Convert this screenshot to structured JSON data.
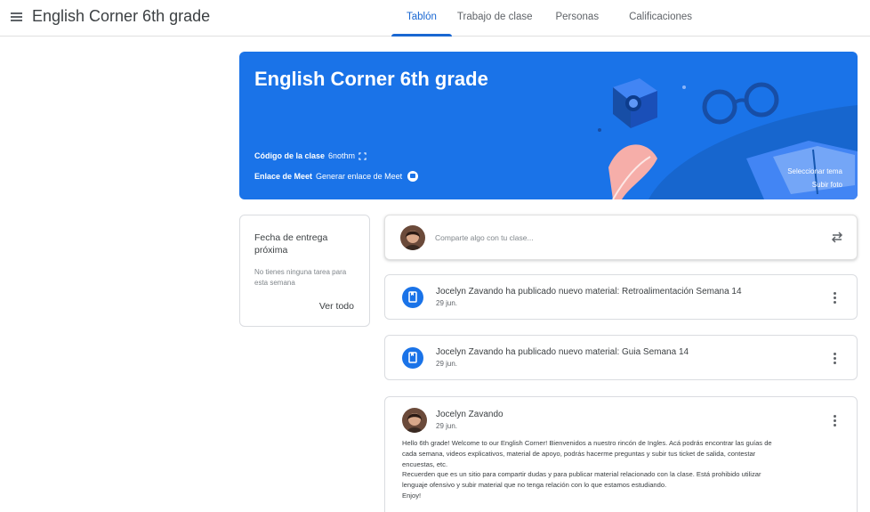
{
  "header": {
    "app_title": "English Corner 6th grade",
    "tabs": [
      {
        "label": "Tablón",
        "active": true
      },
      {
        "label": "Trabajo de clase",
        "active": false
      },
      {
        "label": "Personas",
        "active": false
      },
      {
        "label": "Calificaciones",
        "active": false
      }
    ]
  },
  "banner": {
    "title": "English Corner 6th grade",
    "class_code_label": "Código de la clase",
    "class_code": "6nothm",
    "meet_label": "Enlace de Meet",
    "meet_link_text": "Generar enlace de Meet",
    "select_theme": "Seleccionar tema",
    "upload_photo": "Subir foto",
    "color": "#1a73e8"
  },
  "upcoming": {
    "title": "Fecha de entrega próxima",
    "empty_text": "No tienes ninguna tarea para esta semana",
    "view_all": "Ver todo"
  },
  "share": {
    "placeholder": "Comparte algo con tu clase..."
  },
  "stream": [
    {
      "title": "Jocelyn Zavando ha publicado nuevo material: Retroalimentación Semana 14",
      "date": "29 jun."
    },
    {
      "title": "Jocelyn Zavando ha publicado nuevo material: Guia Semana 14",
      "date": "29 jun."
    }
  ],
  "post": {
    "author": "Jocelyn Zavando",
    "date": "29 jun.",
    "body_lines": [
      "Hello 6th grade! Welcome to our English Corner! Bienvenidos a nuestro rincón de Ingles. Acá podrás encontrar las guías de",
      "cada semana, videos explicativos, material de apoyo, podrás hacerme preguntas y subir tus ticket de salida, contestar",
      "encuestas, etc.",
      "Recuerden que es un sitio para compartir dudas y para publicar material relacionado con la clase. Está prohibido utilizar",
      "lenguaje ofensivo y subir material que no tenga relación con lo que estamos estudiando.",
      "Enjoy!"
    ]
  },
  "icons": {
    "menu": "menu-icon",
    "fullscreen": "fullscreen-icon",
    "meet": "video-camera-icon",
    "repost": "repost-icon",
    "material": "material-book-icon",
    "more": "more-vert-icon"
  },
  "colors": {
    "accent": "#1967d2",
    "banner": "#1a73e8"
  }
}
